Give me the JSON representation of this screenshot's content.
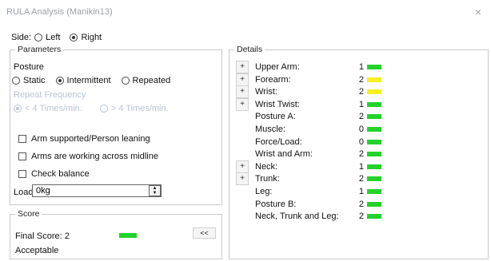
{
  "window": {
    "title": "RULA Analysis (Manikin13)",
    "close_glyph": "×"
  },
  "side": {
    "label": "Side:",
    "options": [
      "Left",
      "Right"
    ],
    "selected": "Right"
  },
  "parameters": {
    "legend": "Parameters",
    "posture_label": "Posture",
    "posture_options": [
      "Static",
      "Intermittent",
      "Repeated"
    ],
    "posture_selected": "Intermittent",
    "repeat_label": "Repeat Frequency",
    "repeat_options": [
      "< 4 Times/min.",
      "> 4 Times/min."
    ],
    "repeat_selected": "< 4 Times/min.",
    "checkboxes": [
      "Arm supported/Person leaning",
      "Arms are working across midline",
      "Check balance"
    ],
    "load_label": "Load:",
    "load_value": "0kg"
  },
  "score": {
    "legend": "Score",
    "final_label": "Final Score: 2",
    "final_color": "#22d32a",
    "verdict": "Acceptable",
    "collapse_label": "<<"
  },
  "details": {
    "legend": "Details",
    "rows": [
      {
        "label": "Upper Arm:",
        "value": "1",
        "color": "green",
        "expandable": true,
        "button": "+"
      },
      {
        "label": "Forearm:",
        "value": "2",
        "color": "yellow",
        "expandable": true,
        "button": "+"
      },
      {
        "label": "Wrist:",
        "value": "2",
        "color": "yellow",
        "expandable": true,
        "button": "+"
      },
      {
        "label": "Wrist Twist:",
        "value": "1",
        "color": "green",
        "expandable": true,
        "button": "+"
      },
      {
        "label": "Posture A:",
        "value": "2",
        "color": "green",
        "expandable": false
      },
      {
        "label": "Muscle:",
        "value": "0",
        "color": "green",
        "expandable": false
      },
      {
        "label": "Force/Load:",
        "value": "0",
        "color": "green",
        "expandable": false
      },
      {
        "label": "Wrist and Arm:",
        "value": "2",
        "color": "green",
        "expandable": false
      },
      {
        "label": "Neck:",
        "value": "1",
        "color": "green",
        "expandable": true,
        "button": "+"
      },
      {
        "label": "Trunk:",
        "value": "2",
        "color": "green",
        "expandable": true,
        "button": "+"
      },
      {
        "label": "Leg:",
        "value": "1",
        "color": "green",
        "expandable": false
      },
      {
        "label": "Posture B:",
        "value": "2",
        "color": "green",
        "expandable": false
      },
      {
        "label": "Neck, Trunk and Leg:",
        "value": "2",
        "color": "green",
        "expandable": false
      }
    ]
  }
}
